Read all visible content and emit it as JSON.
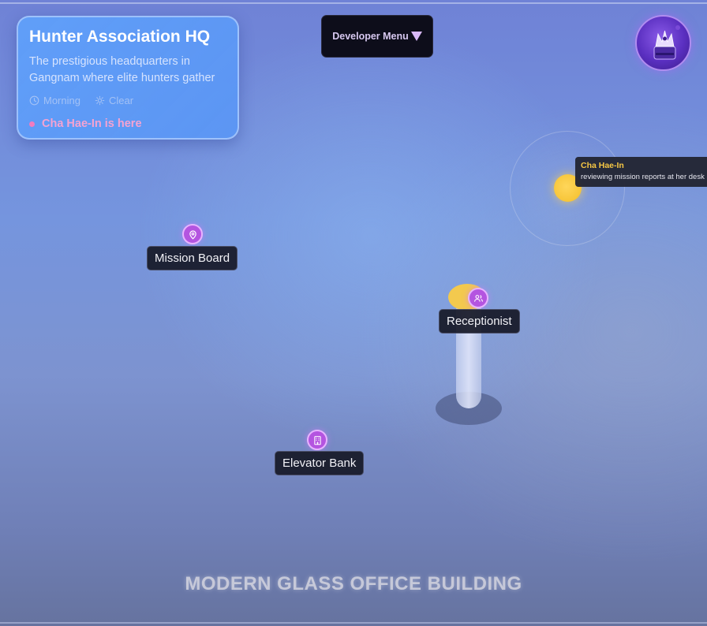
{
  "location": {
    "title": "Hunter Association HQ",
    "description": "The prestigious headquarters in Gangnam where elite hunters gather",
    "time_of_day": "Morning",
    "weather": "Clear",
    "presence": "Cha Hae-In is here"
  },
  "developer_menu": {
    "label": "Developer Menu"
  },
  "avatar": {
    "icon": "crown-chest-icon"
  },
  "points_of_interest": [
    {
      "label": "Mission Board",
      "icon": "map-pin-icon"
    },
    {
      "label": "Receptionist",
      "icon": "users-icon"
    },
    {
      "label": "Elevator Bank",
      "icon": "building-icon"
    }
  ],
  "character": {
    "name": "Cha Hae-In",
    "activity": "reviewing mission reports at her desk"
  },
  "scene_caption": "MODERN GLASS OFFICE BUILDING",
  "colors": {
    "accent_purple": "#b454e0",
    "presence_pink": "#f5a3d2",
    "character_gold": "#f6c744"
  }
}
